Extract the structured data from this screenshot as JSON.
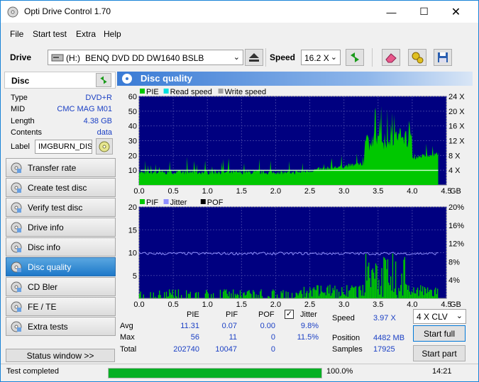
{
  "window": {
    "title": "Opti Drive Control 1.70"
  },
  "menu": [
    "File",
    "Start test",
    "Extra",
    "Help"
  ],
  "toolbar": {
    "drive_label": "Drive",
    "drive_letter": "(H:)",
    "drive_name": "BENQ DVD DD DW1640 BSLB",
    "speed_label": "Speed",
    "speed_value": "16.2 X"
  },
  "disc": {
    "header": "Disc",
    "rows": [
      {
        "k": "Type",
        "v": "DVD+R"
      },
      {
        "k": "MID",
        "v": "CMC MAG M01"
      },
      {
        "k": "Length",
        "v": "4.38 GB"
      },
      {
        "k": "Contents",
        "v": "data"
      }
    ],
    "label_key": "Label",
    "label_value": "IMGBURN_DIS"
  },
  "nav": [
    {
      "label": "Transfer rate",
      "icon": "transfer-rate-icon"
    },
    {
      "label": "Create test disc",
      "icon": "create-test-icon"
    },
    {
      "label": "Verify test disc",
      "icon": "verify-test-icon"
    },
    {
      "label": "Drive info",
      "icon": "drive-info-icon"
    },
    {
      "label": "Disc info",
      "icon": "disc-info-icon"
    },
    {
      "label": "Disc quality",
      "icon": "disc-quality-icon",
      "active": true
    },
    {
      "label": "CD Bler",
      "icon": "cd-bler-icon"
    },
    {
      "label": "FE / TE",
      "icon": "fe-te-icon"
    },
    {
      "label": "Extra tests",
      "icon": "extra-tests-icon"
    }
  ],
  "status_window_label": "Status window >>",
  "panel_title": "Disc quality",
  "chart_data": [
    {
      "type": "area",
      "legend": [
        "PIE",
        "Read speed",
        "Write speed"
      ],
      "colors": {
        "PIE": "#00c800",
        "Read speed": "#00e0e0",
        "Write speed": "#a0a0a0",
        "bg": "#000080"
      },
      "ylim": [
        0,
        60
      ],
      "y_ticks": [
        "10",
        "20",
        "30",
        "40",
        "50",
        "60"
      ],
      "y2_ticks": [
        "4 X",
        "8 X",
        "12 X",
        "16 X",
        "20 X",
        "24 X"
      ],
      "x_ticks": [
        "0.0",
        "0.5",
        "1.0",
        "1.5",
        "2.0",
        "2.5",
        "3.0",
        "3.5",
        "4.0",
        "4.5"
      ],
      "x_unit": "GB",
      "read_speed_level": 3.97
    },
    {
      "type": "bar",
      "legend": [
        "PIF",
        "Jitter",
        "POF"
      ],
      "colors": {
        "PIF": "#00c800",
        "Jitter": "#9090ff",
        "POF": "#000000",
        "bg": "#000080"
      },
      "ylim": [
        0,
        20
      ],
      "y_ticks": [
        "5",
        "10",
        "15",
        "20"
      ],
      "y2_ticks": [
        "4%",
        "8%",
        "12%",
        "16%",
        "20%"
      ],
      "x_ticks": [
        "0.0",
        "0.5",
        "1.0",
        "1.5",
        "2.0",
        "2.5",
        "3.0",
        "3.5",
        "4.0",
        "4.5"
      ],
      "x_unit": "GB",
      "jitter_level": 9.8
    }
  ],
  "stats": {
    "headers": [
      "PIE",
      "PIF",
      "POF",
      "Jitter"
    ],
    "rows": [
      {
        "label": "Avg",
        "pie": "11.31",
        "pif": "0.07",
        "pof": "0.00",
        "jitter": "9.8%"
      },
      {
        "label": "Max",
        "pie": "56",
        "pif": "11",
        "pof": "0",
        "jitter": "11.5%"
      },
      {
        "label": "Total",
        "pie": "202740",
        "pif": "10047",
        "pof": "0",
        "jitter": ""
      }
    ],
    "speed_label": "Speed",
    "speed_value": "3.97 X",
    "position_label": "Position",
    "position_value": "4482 MB",
    "samples_label": "Samples",
    "samples_value": "17925",
    "clv_value": "4 X CLV",
    "start_full": "Start full",
    "start_part": "Start part"
  },
  "statusbar": {
    "text": "Test completed",
    "progress_text": "100.0%",
    "progress": 1.0,
    "time": "14:21"
  }
}
